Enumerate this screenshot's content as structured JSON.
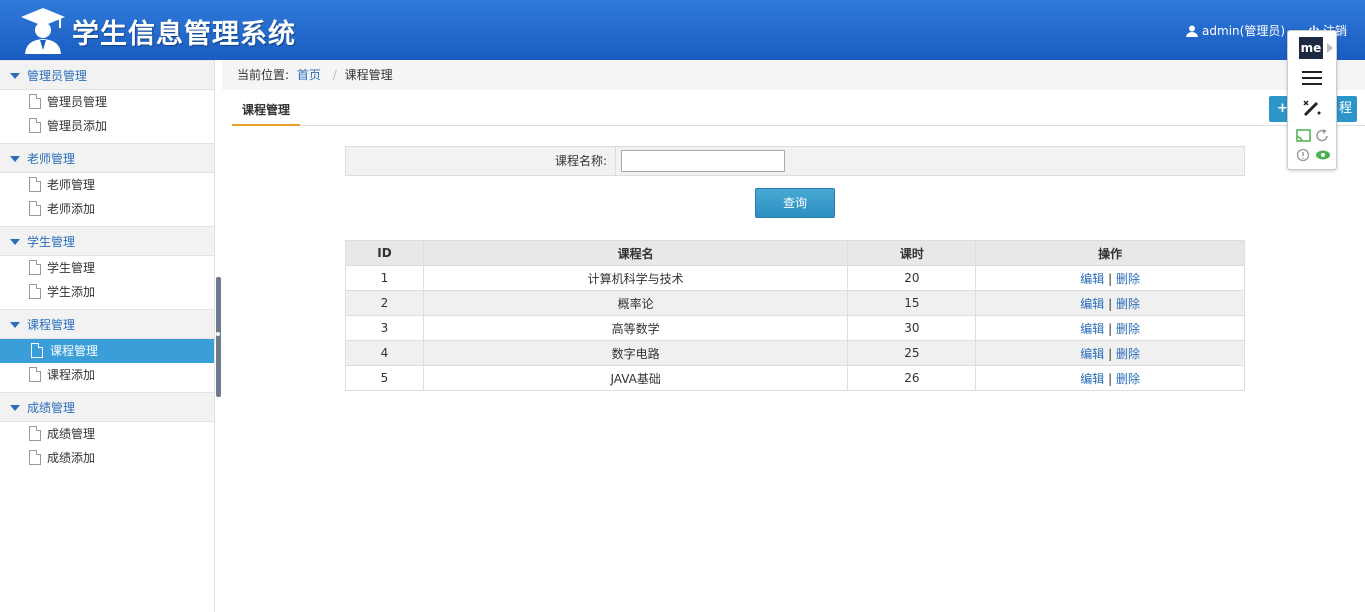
{
  "header": {
    "title": "学生信息管理系统",
    "user": "admin(管理员)",
    "logout": "注销",
    "colors": {
      "bar": "#1a5cc1",
      "accent": "#3a9fd8"
    }
  },
  "sidebar": {
    "groups": [
      {
        "label": "管理员管理",
        "items": [
          "管理员管理",
          "管理员添加"
        ]
      },
      {
        "label": "老师管理",
        "items": [
          "老师管理",
          "老师添加"
        ]
      },
      {
        "label": "学生管理",
        "items": [
          "学生管理",
          "学生添加"
        ]
      },
      {
        "label": "课程管理",
        "items": [
          "课程管理",
          "课程添加"
        ]
      },
      {
        "label": "成绩管理",
        "items": [
          "成绩管理",
          "成绩添加"
        ]
      }
    ]
  },
  "breadcrumb": {
    "prefix": "当前位置:",
    "home": "首页",
    "sep": "/",
    "current": "课程管理"
  },
  "tab": {
    "label": "课程管理"
  },
  "add_button": {
    "label": "程"
  },
  "search": {
    "label": "课程名称:",
    "value": "",
    "button": "查询"
  },
  "table": {
    "headers": [
      "ID",
      "课程名",
      "课时",
      "操作"
    ],
    "rows": [
      {
        "id": "1",
        "name": "计算机科学与技术",
        "hours": "20"
      },
      {
        "id": "2",
        "name": "概率论",
        "hours": "15"
      },
      {
        "id": "3",
        "name": "高等数学",
        "hours": "30"
      },
      {
        "id": "4",
        "name": "数字电路",
        "hours": "25"
      },
      {
        "id": "5",
        "name": "JAVA基础",
        "hours": "26"
      }
    ],
    "edit": "编辑",
    "op_sep": "|",
    "delete": "删除"
  },
  "extension": {
    "me": "me"
  }
}
